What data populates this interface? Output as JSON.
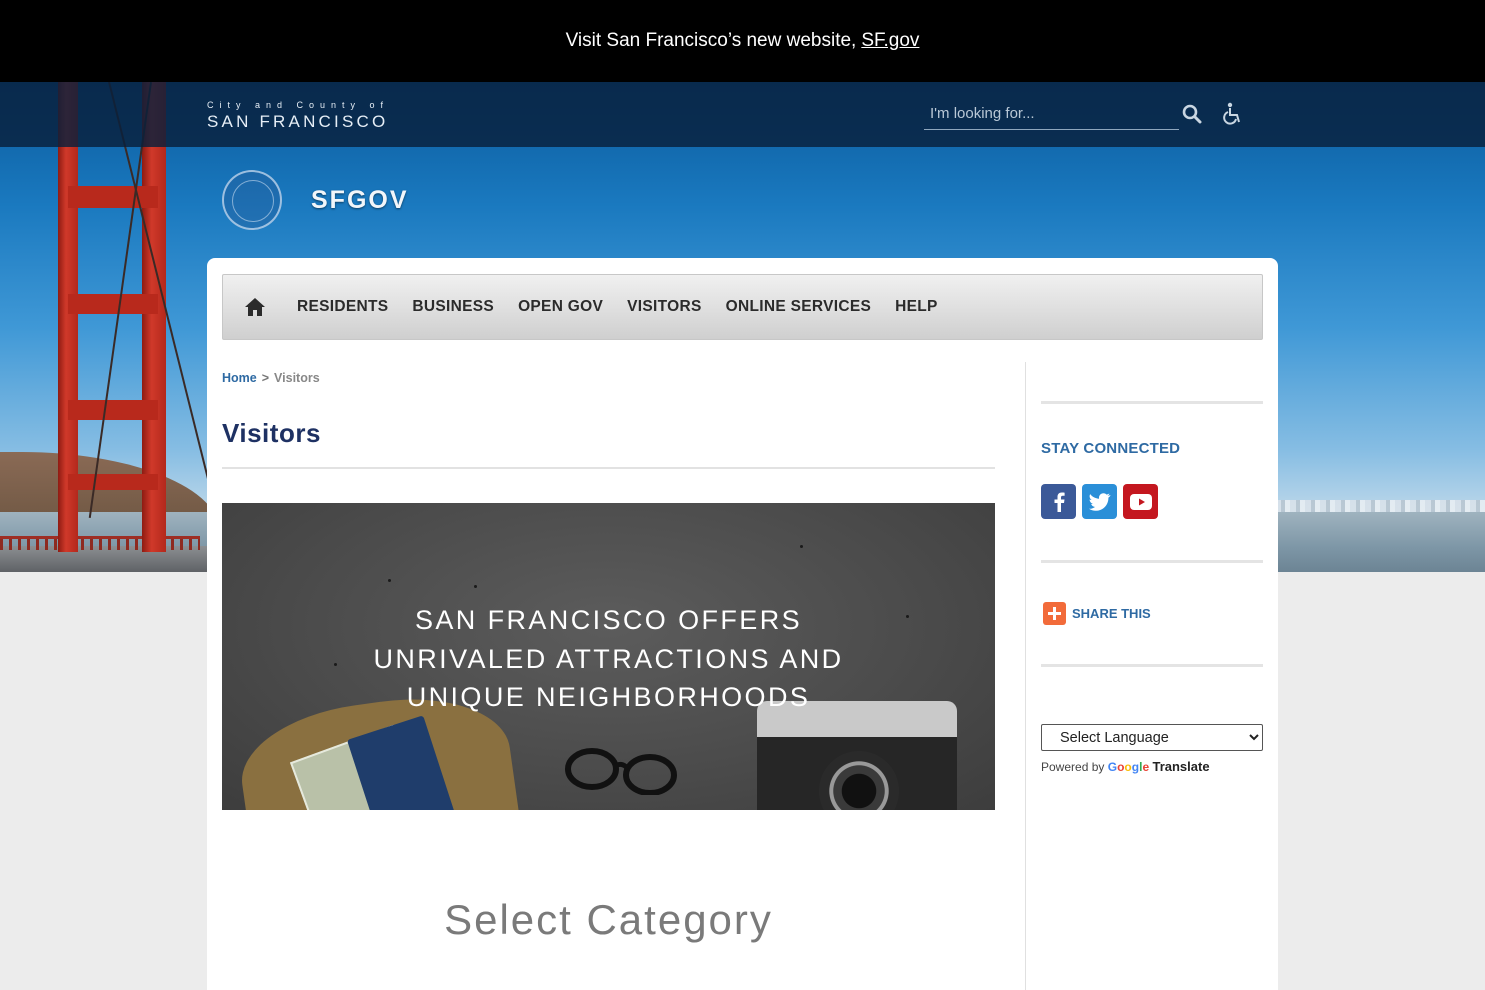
{
  "announcement": {
    "text": "Visit San Francisco’s new website,",
    "link": "SF.gov"
  },
  "header": {
    "logo_small": "City and County of",
    "logo_big": "San Francisco",
    "search_placeholder": "I'm looking for...",
    "site_title": "SFGOV"
  },
  "nav": {
    "items": [
      "RESIDENTS",
      "BUSINESS",
      "OPEN GOV",
      "VISITORS",
      "ONLINE SERVICES",
      "HELP"
    ]
  },
  "breadcrumb": {
    "home": "Home",
    "separator": ">",
    "current": "Visitors"
  },
  "page": {
    "title": "Visitors",
    "banner_text": "SAN FRANCISCO OFFERS UNRIVALED ATTRACTIONS AND UNIQUE NEIGHBORHOODS",
    "select_category": "Select Category"
  },
  "sidebar": {
    "stay_connected": "STAY CONNECTED",
    "social": [
      "facebook-icon",
      "twitter-icon",
      "youtube-icon"
    ],
    "share": "SHARE THIS",
    "language_select": "Select Language",
    "powered_by": "Powered by",
    "google": "Google",
    "translate": "Translate"
  },
  "colors": {
    "facebook": "#3b5998",
    "twitter": "#2a8fd8",
    "youtube": "#c4171f",
    "share": "#f26b3a",
    "title": "#1e3163",
    "link": "#2e6aa3"
  }
}
